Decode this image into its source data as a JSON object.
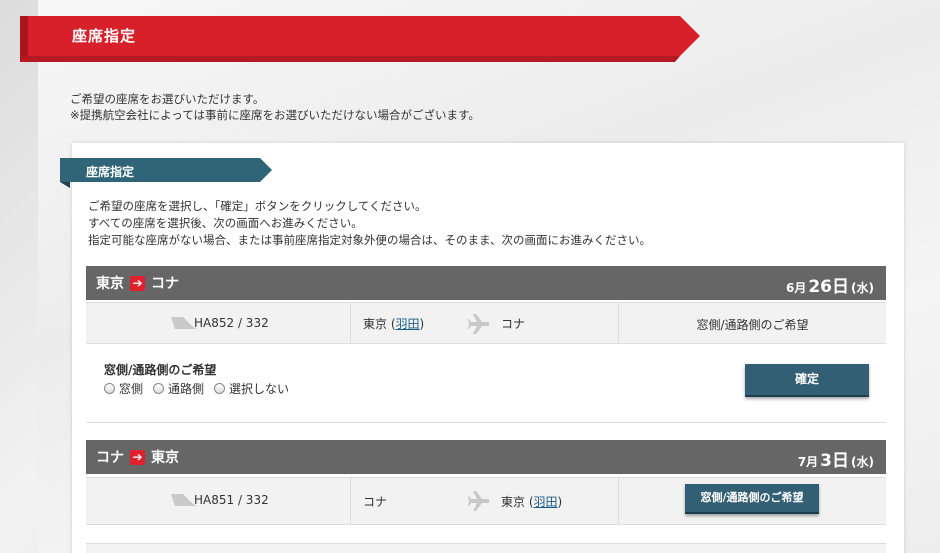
{
  "page": {
    "title": "座席指定",
    "intro_line1": "ご希望の座席をお選びいただけます。",
    "intro_line2": "※提携航空会社によっては事前に座席をお選びいただけない場合がございます。"
  },
  "section": {
    "title": "座席指定",
    "instruction1": "ご希望の座席を選択し、「確定」ボタンをクリックしてください。",
    "instruction2": "すべての座席を選択後、次の画面へお進みください。",
    "instruction3": "指定可能な座席がない場合、または事前座席指定対象外便の場合は、そのまま、次の画面にお進みください。"
  },
  "flights": [
    {
      "from": "東京",
      "to": "コナ",
      "month": "6月",
      "day": "26日",
      "weekday": "(水)",
      "flight_no": "HA852 / 332",
      "dep_city": "東京 (",
      "dep_airport": "羽田",
      "dep_close": ")",
      "arr_city": "コナ",
      "arr_airport": "",
      "arr_close": "",
      "pref_label": "窓側/通路側のご希望",
      "pref_heading": "窓側/通路側のご希望",
      "options": [
        "窓側",
        "通路側",
        "選択しない"
      ],
      "confirm": "確定"
    },
    {
      "from": "コナ",
      "to": "東京",
      "month": "7月",
      "day": "3日",
      "weekday": "(水)",
      "flight_no": "HA851 / 332",
      "dep_city": "コナ",
      "arr_city": "東京 (",
      "arr_airport": "羽田",
      "arr_close": ")",
      "pref_button": "窓側/通路側のご希望"
    }
  ],
  "colors": {
    "brand_red": "#d7202a",
    "section_blue": "#2f6577",
    "header_gray": "#666666",
    "button_blue": "#335f74"
  }
}
